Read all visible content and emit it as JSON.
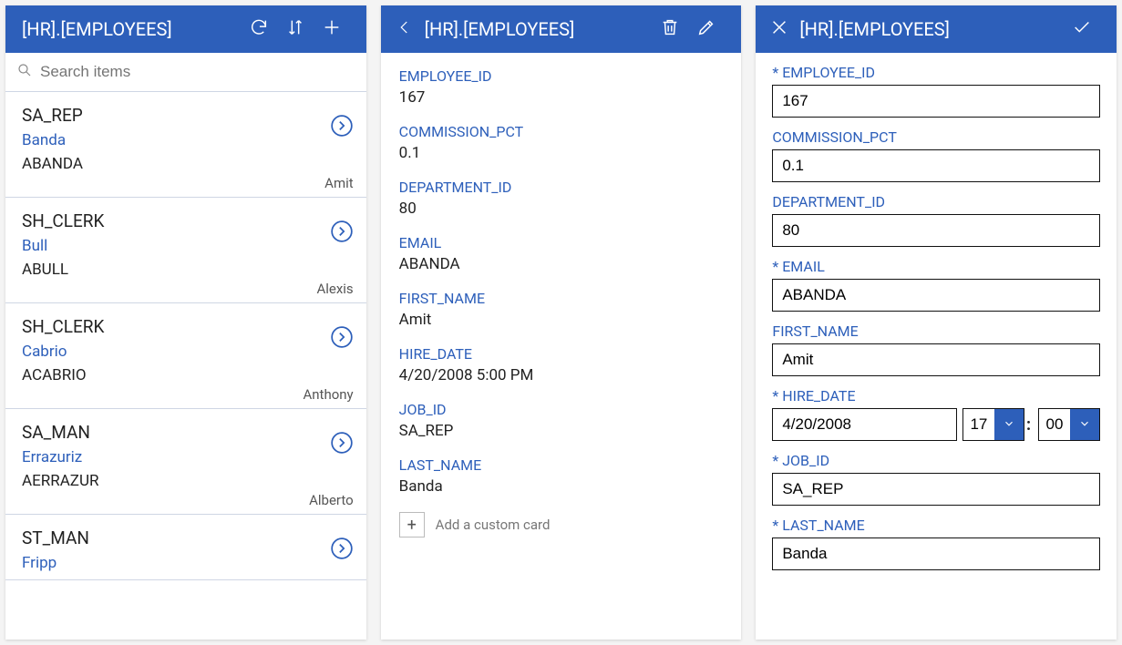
{
  "panelA": {
    "title": "[HR].[EMPLOYEES]",
    "searchPlaceholder": "Search items",
    "items": [
      {
        "job": "SA_REP",
        "lastname": "Banda",
        "email": "ABANDA",
        "firstname": "Amit"
      },
      {
        "job": "SH_CLERK",
        "lastname": "Bull",
        "email": "ABULL",
        "firstname": "Alexis"
      },
      {
        "job": "SH_CLERK",
        "lastname": "Cabrio",
        "email": "ACABRIO",
        "firstname": "Anthony"
      },
      {
        "job": "SA_MAN",
        "lastname": "Errazuriz",
        "email": "AERRAZUR",
        "firstname": "Alberto"
      },
      {
        "job": "ST_MAN",
        "lastname": "Fripp",
        "email": "",
        "firstname": ""
      }
    ]
  },
  "panelB": {
    "title": "[HR].[EMPLOYEES]",
    "fields": [
      {
        "label": "EMPLOYEE_ID",
        "value": "167"
      },
      {
        "label": "COMMISSION_PCT",
        "value": "0.1"
      },
      {
        "label": "DEPARTMENT_ID",
        "value": "80"
      },
      {
        "label": "EMAIL",
        "value": "ABANDA"
      },
      {
        "label": "FIRST_NAME",
        "value": "Amit"
      },
      {
        "label": "HIRE_DATE",
        "value": "4/20/2008 5:00 PM"
      },
      {
        "label": "JOB_ID",
        "value": "SA_REP"
      },
      {
        "label": "LAST_NAME",
        "value": "Banda"
      }
    ],
    "addCardLabel": "Add a custom card"
  },
  "panelC": {
    "title": "[HR].[EMPLOYEES]",
    "fields": {
      "employee_id": {
        "label": "EMPLOYEE_ID",
        "value": "167",
        "required": true
      },
      "commission_pct": {
        "label": "COMMISSION_PCT",
        "value": "0.1",
        "required": false
      },
      "department_id": {
        "label": "DEPARTMENT_ID",
        "value": "80",
        "required": false
      },
      "email": {
        "label": "EMAIL",
        "value": "ABANDA",
        "required": true
      },
      "first_name": {
        "label": "FIRST_NAME",
        "value": "Amit",
        "required": false
      },
      "hire_date": {
        "label": "HIRE_DATE",
        "date": "4/20/2008",
        "hour": "17",
        "minute": "00",
        "required": true
      },
      "job_id": {
        "label": "JOB_ID",
        "value": "SA_REP",
        "required": true
      },
      "last_name": {
        "label": "LAST_NAME",
        "value": "Banda",
        "required": true
      }
    }
  }
}
